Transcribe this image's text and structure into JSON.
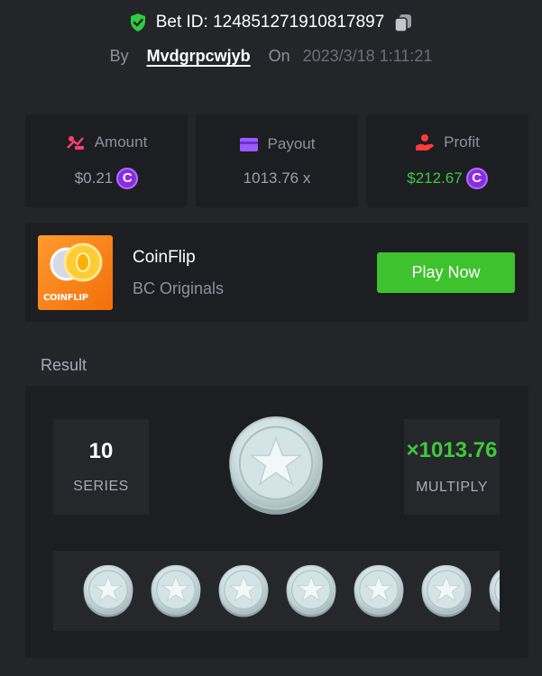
{
  "header": {
    "bet_label": "Bet ID: 124851271910817897",
    "by_label": "By",
    "username": "Mvdgrpcwjyb",
    "on_label": "On",
    "datetime": "2023/3/18 1:11:21"
  },
  "stats": {
    "amount": {
      "label": "Amount",
      "value": "$0.21",
      "icon": "money-bag-icon",
      "coin": "C"
    },
    "payout": {
      "label": "Payout",
      "value": "1013.76 x",
      "icon": "wallet-icon"
    },
    "profit": {
      "label": "Profit",
      "value": "$212.67",
      "icon": "hand-coin-icon",
      "coin": "C"
    }
  },
  "game": {
    "thumb_label": "COINFLIP",
    "name": "CoinFlip",
    "provider": "BC Originals",
    "play_label": "Play Now"
  },
  "result": {
    "label": "Result",
    "series_value": "10",
    "series_label": "SERIES",
    "multiply_value": "×1013.76",
    "multiply_label": "MULTIPLY",
    "coin_count_visible": 7
  },
  "colors": {
    "background": "#232529",
    "card": "#1c1e22",
    "green": "#3ec22d",
    "purple_coin": "#8a2be2",
    "shield_green": "#2ecc40"
  }
}
